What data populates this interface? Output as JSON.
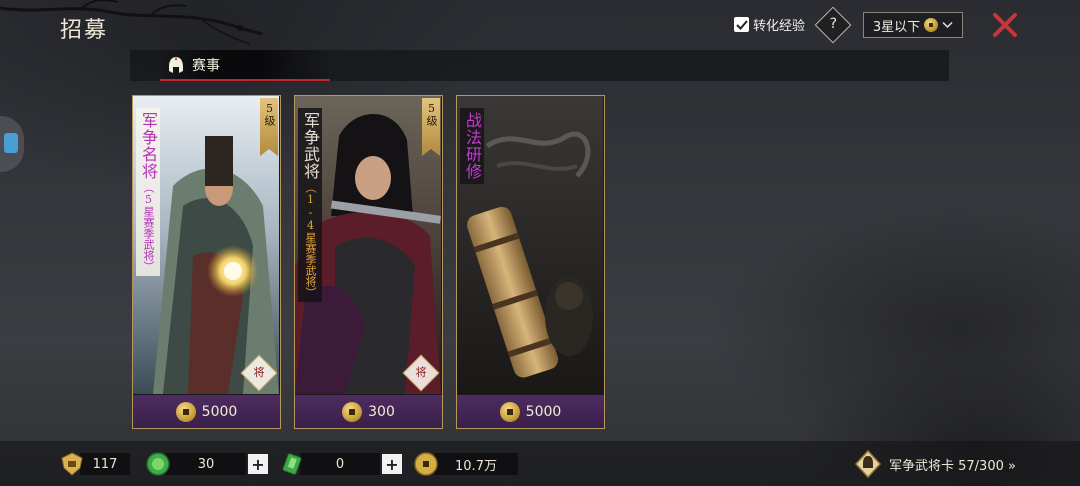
{
  "header": {
    "title": "招募",
    "convert_label": "转化经验",
    "convert_checked": true,
    "help_label": "?",
    "filter_label": "3星以下",
    "filter_icon": "copper-coin-icon",
    "close_icon": "close-icon"
  },
  "tabs": [
    {
      "label": "赛事",
      "icon": "helmet-icon",
      "active": true
    }
  ],
  "cards": [
    {
      "name": "军争名将",
      "subtitle": "（5星赛季武将）",
      "level": "5级",
      "badge": "将",
      "cost": "5000",
      "cost_icon": "copper-coin-icon"
    },
    {
      "name": "军争武将",
      "subtitle": "（1-4星赛季武将）",
      "level": "5级",
      "badge": "将",
      "cost": "300",
      "cost_icon": "copper-coin-icon"
    },
    {
      "name": "战法研修",
      "subtitle": "",
      "level": "",
      "badge": "",
      "cost": "5000",
      "cost_icon": "copper-coin-icon"
    }
  ],
  "resources": [
    {
      "icon": "honor-shield-icon",
      "value": "117"
    },
    {
      "icon": "jade-coin-icon",
      "value": "30",
      "add": "+"
    },
    {
      "icon": "green-token-icon",
      "value": "0",
      "add": "+"
    },
    {
      "icon": "copper-coin-icon",
      "value": "10.7万"
    }
  ],
  "general_card": {
    "icon": "general-card-icon",
    "label": "军争武将卡 57/300 »"
  },
  "colors": {
    "accent_red": "#c0262a",
    "card_border": "#b5985a",
    "cost_purple": "#4e2c61",
    "name_purple": "#b433b8"
  }
}
